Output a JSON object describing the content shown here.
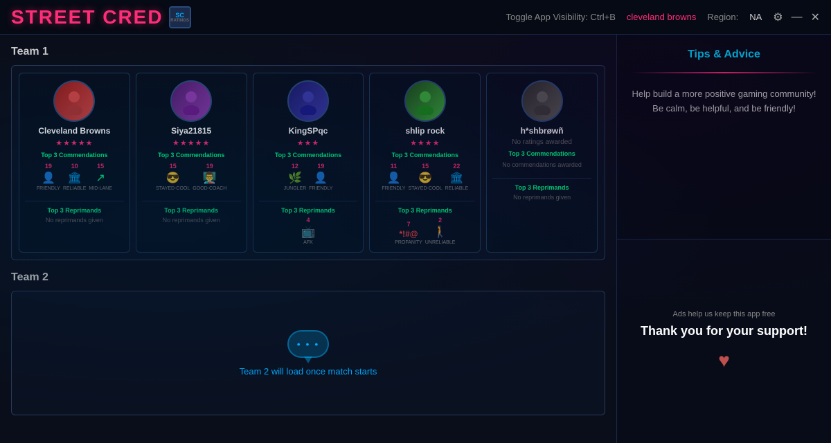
{
  "app": {
    "title": "STREET CRED",
    "badge": "SC",
    "toggle_label": "Toggle App Visibility: Ctrl+B",
    "active_user": "cleveland browns",
    "region_label": "Region:",
    "region_value": "NA"
  },
  "header_icons": {
    "gear": "⚙",
    "minimize": "—",
    "close": "✕"
  },
  "team1": {
    "label": "Team 1",
    "players": [
      {
        "name": "Cleveland Browns",
        "stars": "★★★★★",
        "commend_label": "Top 3 Commendations",
        "commends": [
          {
            "num": "19",
            "icon": "👤",
            "tag": "FRIENDLY"
          },
          {
            "num": "10",
            "icon": "🏛",
            "tag": "RELIABLE"
          },
          {
            "num": "15",
            "icon": "↗",
            "tag": "MID-LANE"
          }
        ],
        "reprimand_label": "Top 3 Reprimands",
        "no_reprimand": "No reprimands given"
      },
      {
        "name": "Siya21815",
        "stars": "★★★★★",
        "commend_label": "Top 3 Commendations",
        "commends": [
          {
            "num": "15",
            "icon": "😎",
            "tag": "STAYED-COOL"
          },
          {
            "num": "19",
            "icon": "🎓",
            "tag": "GOOD-COACH"
          }
        ],
        "reprimand_label": "Top 3 Reprimands",
        "no_reprimand": "No reprimands given"
      },
      {
        "name": "KingSPqc",
        "stars": "★★★",
        "commend_label": "Top 3 Commendations",
        "commends": [
          {
            "num": "12",
            "icon": "🌿",
            "tag": "JUNGLER"
          },
          {
            "num": "19",
            "icon": "👤",
            "tag": "FRIENDLY"
          }
        ],
        "reprimand_label": "Top 3 Reprimands",
        "reprimands": [
          {
            "num": "4",
            "icon": "📺",
            "tag": "AFK"
          }
        ]
      },
      {
        "name": "shlip rock",
        "stars": "★★★★",
        "commend_label": "Top 3 Commendations",
        "commends": [
          {
            "num": "11",
            "icon": "👤",
            "tag": "FRIENDLY"
          },
          {
            "num": "15",
            "icon": "😎",
            "tag": "STAYED-COOL"
          },
          {
            "num": "22",
            "icon": "🏛",
            "tag": "RELIABLE"
          }
        ],
        "reprimand_label": "Top 3 Reprimands",
        "reprimands": [
          {
            "num": "7",
            "icon": "*!#@",
            "tag": "PROFANITY"
          },
          {
            "num": "2",
            "icon": "🚶",
            "tag": "UNRELIABLE"
          }
        ]
      },
      {
        "name": "h*shbrøwñ",
        "stars": null,
        "no_ratings": "No ratings awarded",
        "commend_label": "Top 3 Commendations",
        "no_commend": "No commendations awarded",
        "reprimand_label": "Top 3 Reprimands",
        "no_reprimand": "No reprimands given"
      }
    ]
  },
  "team2": {
    "label": "Team 2",
    "waiting_text": "Team 2 will load once match starts"
  },
  "sidebar": {
    "tips_title": "Tips & Advice",
    "tips_text": "Help build a more positive gaming community! Be calm, be helpful, and be friendly!",
    "ads_small": "Ads help us keep this app free",
    "ads_thank": "Thank you for your support!",
    "heart": "♥"
  }
}
